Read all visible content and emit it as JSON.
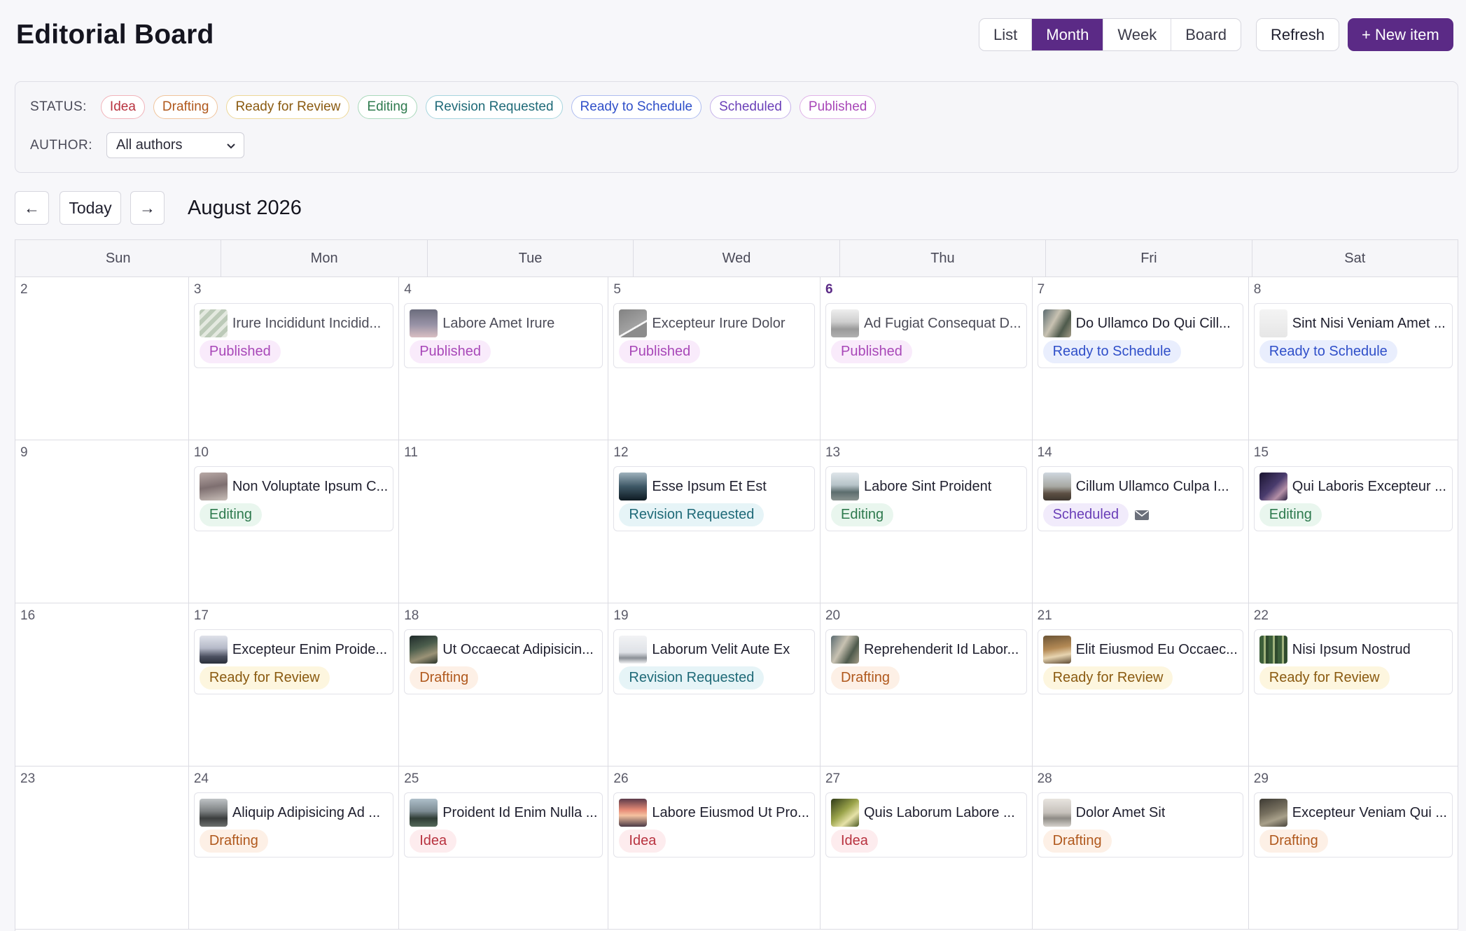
{
  "header": {
    "title": "Editorial Board",
    "views": [
      "List",
      "Month",
      "Week",
      "Board"
    ],
    "active_view": "Month",
    "refresh_label": "Refresh",
    "new_item_label": "+ New item"
  },
  "filters": {
    "status_label": "STATUS:",
    "statuses": [
      "Idea",
      "Drafting",
      "Ready for Review",
      "Editing",
      "Revision Requested",
      "Ready to Schedule",
      "Scheduled",
      "Published"
    ],
    "author_label": "AUTHOR:",
    "author_value": "All authors"
  },
  "nav": {
    "prev_label": "←",
    "today_label": "Today",
    "next_label": "→",
    "month_title": "August 2026"
  },
  "calendar": {
    "weekdays": [
      "Sun",
      "Mon",
      "Tue",
      "Wed",
      "Thu",
      "Fri",
      "Sat"
    ],
    "today": "6",
    "weeks": [
      [
        {
          "day": "2",
          "items": []
        },
        {
          "day": "3",
          "items": [
            {
              "title": "Irure Incididunt Incidid...",
              "status": "Published",
              "thumb": "stripes"
            }
          ]
        },
        {
          "day": "4",
          "items": [
            {
              "title": "Labore Amet Irure",
              "status": "Published",
              "thumb": "dusk"
            }
          ]
        },
        {
          "day": "5",
          "items": [
            {
              "title": "Excepteur Irure Dolor",
              "status": "Published",
              "thumb": "gray"
            }
          ]
        },
        {
          "day": "6",
          "items": [
            {
              "title": "Ad Fugiat Consequat D...",
              "status": "Published",
              "thumb": "city"
            }
          ]
        },
        {
          "day": "7",
          "items": [
            {
              "title": "Do Ullamco Do Qui Cill...",
              "status": "Ready to Schedule",
              "thumb": "rock"
            }
          ]
        },
        {
          "day": "8",
          "items": [
            {
              "title": "Sint Nisi Veniam Amet ...",
              "status": "Ready to Schedule",
              "thumb": "white"
            }
          ]
        }
      ],
      [
        {
          "day": "9",
          "items": []
        },
        {
          "day": "10",
          "items": [
            {
              "title": "Non Voluptate Ipsum C...",
              "status": "Editing",
              "thumb": "sand"
            }
          ]
        },
        {
          "day": "11",
          "items": []
        },
        {
          "day": "12",
          "items": [
            {
              "title": "Esse Ipsum Et Est",
              "status": "Revision Requested",
              "thumb": "lake"
            }
          ]
        },
        {
          "day": "13",
          "items": [
            {
              "title": "Labore Sint Proident",
              "status": "Editing",
              "thumb": "mountain"
            }
          ]
        },
        {
          "day": "14",
          "items": [
            {
              "title": "Cillum Ullamco Culpa I...",
              "status": "Scheduled",
              "thumb": "rail",
              "icon": "mail-icon"
            }
          ]
        },
        {
          "day": "15",
          "items": [
            {
              "title": "Qui Laboris Excepteur ...",
              "status": "Editing",
              "thumb": "night"
            }
          ]
        }
      ],
      [
        {
          "day": "16",
          "items": []
        },
        {
          "day": "17",
          "items": [
            {
              "title": "Excepteur Enim Proide...",
              "status": "Ready for Review",
              "thumb": "fog"
            }
          ]
        },
        {
          "day": "18",
          "items": [
            {
              "title": "Ut Occaecat Adipisicin...",
              "status": "Drafting",
              "thumb": "forest"
            }
          ]
        },
        {
          "day": "19",
          "items": [
            {
              "title": "Laborum Velit Aute Ex",
              "status": "Revision Requested",
              "thumb": "snow"
            }
          ]
        },
        {
          "day": "20",
          "items": [
            {
              "title": "Reprehenderit Id Labor...",
              "status": "Drafting",
              "thumb": "rock"
            }
          ]
        },
        {
          "day": "21",
          "items": [
            {
              "title": "Elit Eiusmod Eu Occaec...",
              "status": "Ready for Review",
              "thumb": "desk"
            }
          ]
        },
        {
          "day": "22",
          "items": [
            {
              "title": "Nisi Ipsum Nostrud",
              "status": "Ready for Review",
              "thumb": "bamboo"
            }
          ]
        }
      ],
      [
        {
          "day": "23",
          "items": []
        },
        {
          "day": "24",
          "items": [
            {
              "title": "Aliquip Adipisicing Ad ...",
              "status": "Drafting",
              "thumb": "road"
            }
          ]
        },
        {
          "day": "25",
          "items": [
            {
              "title": "Proident Id Enim Nulla ...",
              "status": "Idea",
              "thumb": "castle"
            }
          ]
        },
        {
          "day": "26",
          "items": [
            {
              "title": "Labore Eiusmod Ut Pro...",
              "status": "Idea",
              "thumb": "sunset"
            }
          ]
        },
        {
          "day": "27",
          "items": [
            {
              "title": "Quis Laborum Labore ...",
              "status": "Idea",
              "thumb": "leaf"
            }
          ]
        },
        {
          "day": "28",
          "items": [
            {
              "title": "Dolor Amet Sit",
              "status": "Drafting",
              "thumb": "beach"
            }
          ]
        },
        {
          "day": "29",
          "items": [
            {
              "title": "Excepteur Veniam Qui ...",
              "status": "Drafting",
              "thumb": "ruin"
            }
          ]
        }
      ]
    ]
  },
  "status_colors": {
    "Idea": {
      "fg": "#b8323f",
      "bg": "#fdecee",
      "border": "#f1b3ba"
    },
    "Drafting": {
      "fg": "#b0581c",
      "bg": "#fdf0e6",
      "border": "#f0c49c"
    },
    "Ready for Review": {
      "fg": "#8a5a10",
      "bg": "#fdf6df",
      "border": "#eed898"
    },
    "Editing": {
      "fg": "#2e7a4e",
      "bg": "#e9f6ee",
      "border": "#a9d9bb"
    },
    "Revision Requested": {
      "fg": "#1f6a78",
      "bg": "#e6f4f7",
      "border": "#a6d5de"
    },
    "Ready to Schedule": {
      "fg": "#2f4fc9",
      "bg": "#e9eefd",
      "border": "#aebcf0"
    },
    "Scheduled": {
      "fg": "#6a3fb8",
      "bg": "#f1ebfb",
      "border": "#c6b2ea"
    },
    "Published": {
      "fg": "#a847b8",
      "bg": "#f9ebfb",
      "border": "#e0b2e8"
    }
  },
  "accent": "#5b2a86"
}
